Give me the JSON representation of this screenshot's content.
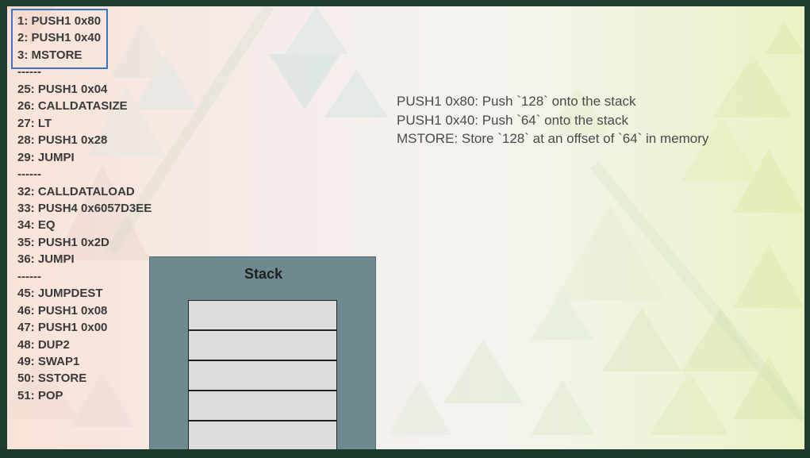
{
  "code_lines": [
    "1: PUSH1 0x80",
    "2: PUSH1 0x40",
    "3: MSTORE",
    "------",
    "25: PUSH1 0x04",
    "26: CALLDATASIZE",
    "27: LT",
    "28: PUSH1 0x28",
    "29: JUMPI",
    "------",
    "32: CALLDATALOAD",
    "33: PUSH4 0x6057D3EE",
    "34: EQ",
    "35: PUSH1 0x2D",
    "36: JUMPI",
    "------",
    "45: JUMPDEST",
    "46: PUSH1 0x08",
    "47: PUSH1 0x00",
    "48: DUP2",
    "49: SWAP1",
    "50: SSTORE",
    "51: POP"
  ],
  "highlight_color": "#3d73c4",
  "explanations": [
    "PUSH1 0x80: Push `128` onto the stack",
    "PUSH1 0x40: Push `64` onto the stack",
    "MSTORE: Store `128` at an offset of `64` in memory"
  ],
  "stack": {
    "title": "Stack",
    "slots": [
      "",
      "",
      "",
      "",
      ""
    ],
    "panel_color": "#6e8a90",
    "slot_color": "#dcdcdc"
  }
}
